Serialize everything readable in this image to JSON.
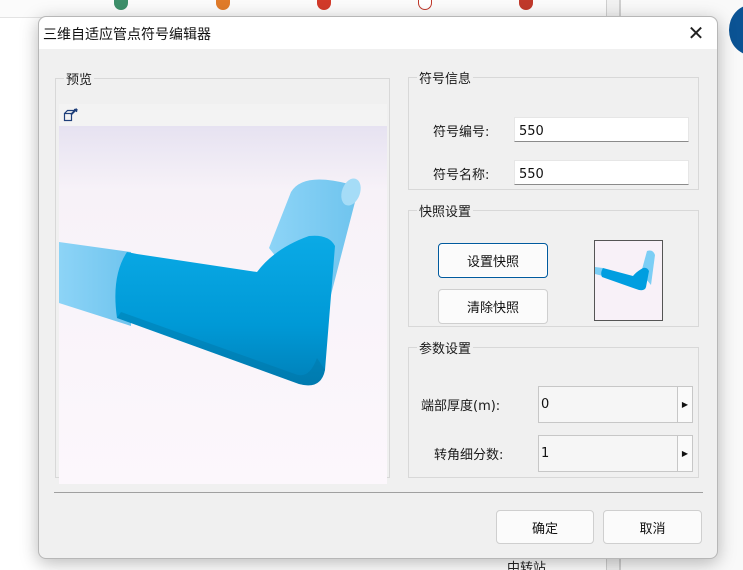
{
  "dialog": {
    "title": "三维自适应管点符号编辑器",
    "close_glyph": "✕"
  },
  "preview": {
    "label": "预览",
    "tool_icon": "box-arrow-icon"
  },
  "symbol_info": {
    "label": "符号信息",
    "number_label": "符号编号:",
    "number_value": "550",
    "name_label": "符号名称:",
    "name_value": "550"
  },
  "snapshot": {
    "label": "快照设置",
    "set_button": "设置快照",
    "clear_button": "清除快照"
  },
  "params": {
    "label": "参数设置",
    "thickness_label": "端部厚度(m):",
    "thickness_value": "0",
    "subdiv_label": "转角细分数:",
    "subdiv_value": "1",
    "spin_glyph": "▶"
  },
  "footer": {
    "ok_button": "确定",
    "cancel_button": "取消"
  },
  "background": {
    "bottom_text": "中转站"
  },
  "colors": {
    "pipe_main": "#009ee0",
    "pipe_light": "#7ccef5",
    "accent": "#005a9e"
  }
}
